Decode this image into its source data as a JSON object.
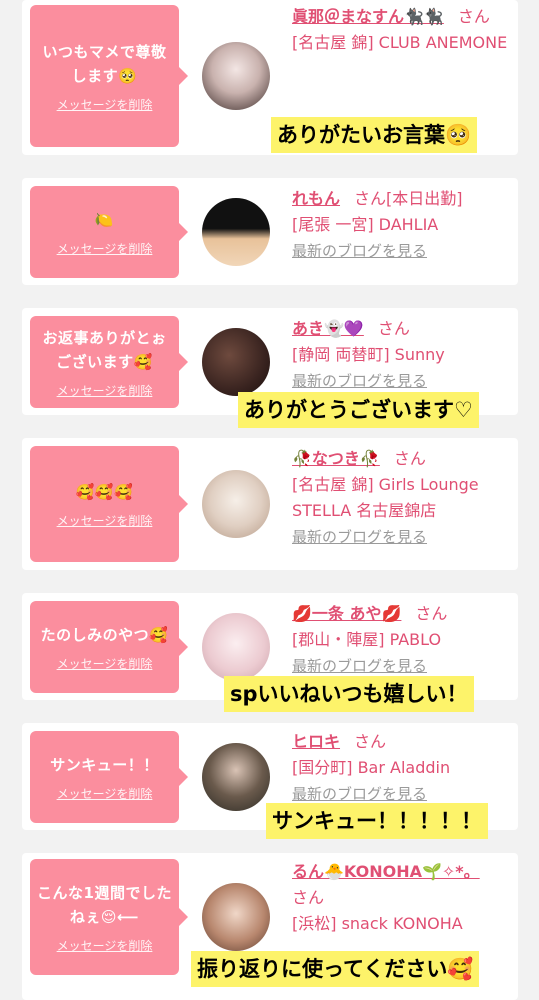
{
  "colors": {
    "bubble": "#fb8e9e",
    "link": "#e04f73",
    "overlay": "#fdf36a"
  },
  "entries": [
    {
      "message": "いつもマメで尊敬します🥺",
      "delete": "メッセージを削除",
      "name": "眞那＠まなすん🐈‍⬛🐈‍⬛",
      "san": "さん",
      "shop": "[名古屋 錦] CLUB ANEMONE",
      "blog": ""
    },
    {
      "message": "🍋",
      "delete": "メッセージを削除",
      "name": "れもん",
      "san": "さん[本日出勤]",
      "shop": "[尾張 一宮] DAHLIA",
      "blog": "最新のブログを見る"
    },
    {
      "message": "お返事ありがとぉございます🥰",
      "delete": "メッセージを削除",
      "name": "あき👻💜",
      "san": "さん",
      "shop": "[静岡 両替町] Sunny",
      "blog": "最新のブログを見る"
    },
    {
      "message": "🥰🥰🥰",
      "delete": "メッセージを削除",
      "name": "🥀なつき🥀",
      "san": "さん",
      "shop": "[名古屋 錦] Girls Lounge STELLA 名古屋錦店",
      "blog": "最新のブログを見る"
    },
    {
      "message": "たのしみのやつ🥰",
      "delete": "メッセージを削除",
      "name": "💋一条 あや💋",
      "san": "さん",
      "shop": "[郡山・陣屋] PABLO",
      "blog": "最新のブログを見る"
    },
    {
      "message": "サンキュー！！",
      "delete": "メッセージを削除",
      "name": "ヒロキ",
      "san": "さん",
      "shop": "[国分町] Bar Aladdin",
      "blog": "最新のブログを見る"
    },
    {
      "message": "こんな1週間でしたねぇ😌⟵",
      "delete": "メッセージを削除",
      "name": "るん🐣KONOHA🌱✧*。",
      "san": "さん",
      "shop": "[浜松] snack KONOHA",
      "blog": ""
    }
  ],
  "overlays": [
    "ありがたいお言葉🥺",
    "ありがとうございます♡",
    "spいいねいつも嬉しい！",
    "サンキュー！！！！！",
    "振り返りに使ってください🥰"
  ]
}
